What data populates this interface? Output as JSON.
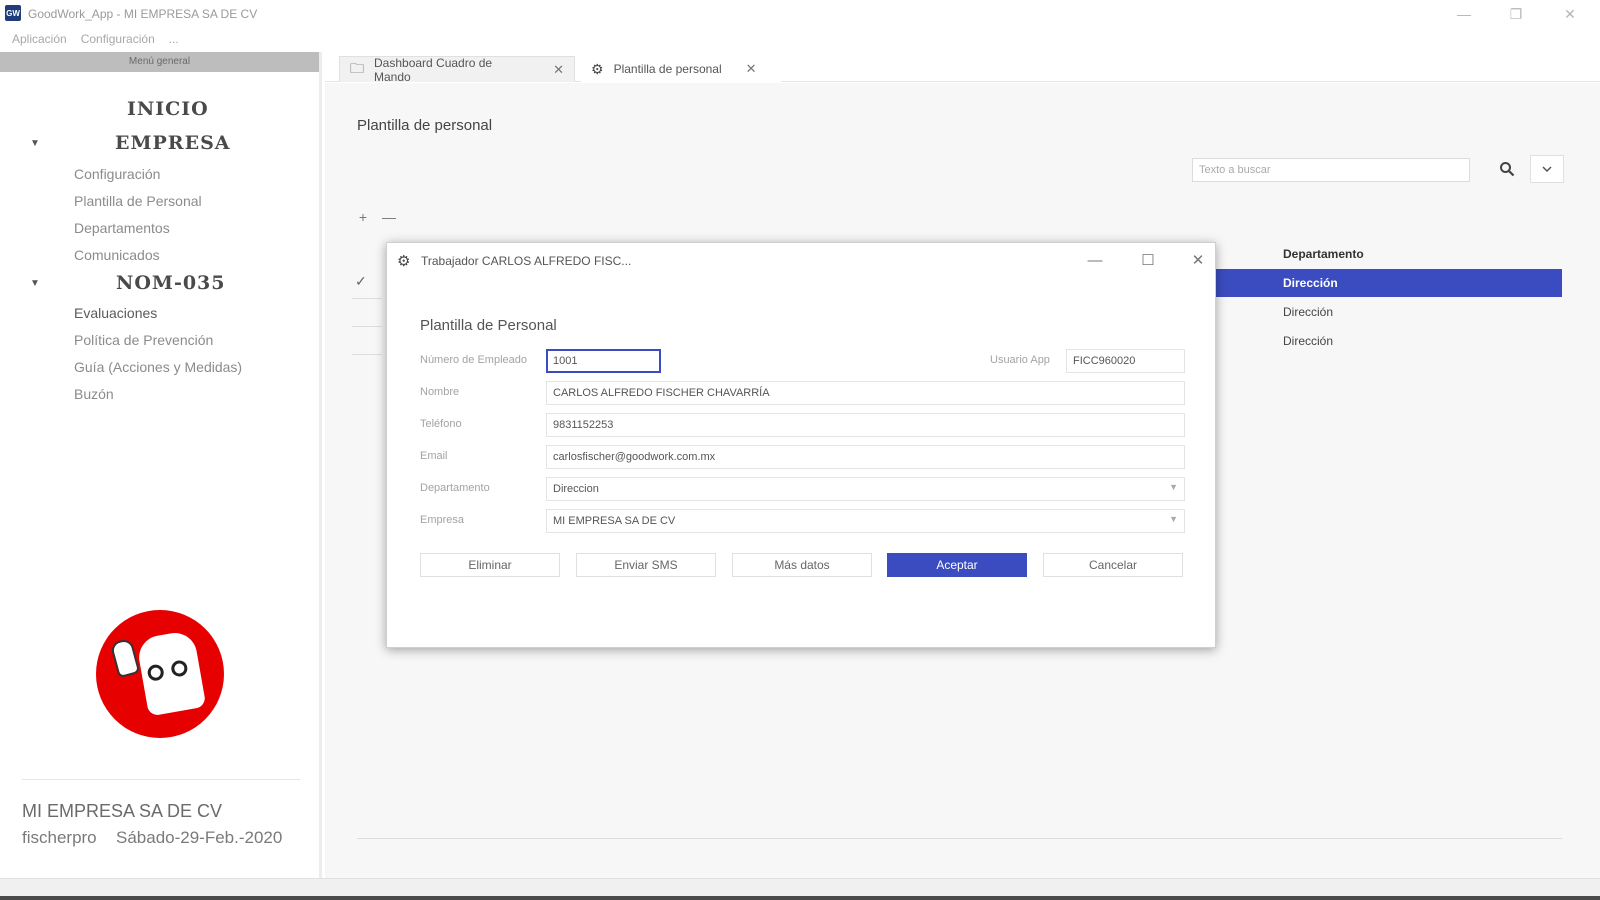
{
  "window": {
    "icon": "GW",
    "title": "GoodWork_App - MI EMPRESA SA DE CV",
    "minimize_icon": "—",
    "restore_icon": "❐",
    "close_icon": "✕"
  },
  "menubar": {
    "items": [
      "Aplicación",
      "Configuración",
      "..."
    ]
  },
  "sidebar": {
    "header": "Menú general",
    "sections": [
      {
        "heading": "INICIO"
      },
      {
        "heading": "EMPRESA",
        "items": [
          "Configuración",
          "Plantilla de Personal",
          "Departamentos",
          "Comunicados"
        ]
      },
      {
        "heading": "NOM-035",
        "items": [
          "Evaluaciones",
          "Política de Prevención",
          "Guía (Acciones y Medidas)",
          "Buzón"
        ]
      }
    ],
    "footer": {
      "company": "MI EMPRESA SA DE CV",
      "user": "fischerpro",
      "date": "Sábado-29-Feb.-2020"
    }
  },
  "tabs": [
    {
      "label": "Dashboard Cuadro de Mando",
      "icon": "folder-icon",
      "active": false
    },
    {
      "label": "Plantilla de personal",
      "icon": "gear-icon",
      "active": true
    }
  ],
  "main": {
    "title": "Plantilla de personal",
    "search_placeholder": "Texto a buscar",
    "add_symbol": "+",
    "remove_symbol": "—",
    "table": {
      "column_header": "Departamento",
      "rows": [
        "Dirección",
        "Dirección",
        "Dirección"
      ]
    }
  },
  "dialog": {
    "title": "Trabajador CARLOS ALFREDO FISC...",
    "form_title": "Plantilla de Personal",
    "fields": {
      "employee_number": {
        "label": "Número de Empleado",
        "value": "1001"
      },
      "app_user": {
        "label": "Usuario App",
        "value": "FICC960020"
      },
      "name": {
        "label": "Nombre",
        "value": "CARLOS ALFREDO FISCHER CHAVARRÍA"
      },
      "phone": {
        "label": "Teléfono",
        "value": "9831152253"
      },
      "email": {
        "label": "Email",
        "value": "carlosfischer@goodwork.com.mx"
      },
      "department": {
        "label": "Departamento",
        "value": "Direccion"
      },
      "company": {
        "label": "Empresa",
        "value": "MI EMPRESA SA DE CV"
      }
    },
    "buttons": {
      "delete": "Eliminar",
      "send_sms": "Enviar SMS",
      "more_data": "Más datos",
      "accept": "Aceptar",
      "cancel": "Cancelar"
    }
  },
  "colors": {
    "accent": "#3a4cbf",
    "logo_red": "#e60000"
  }
}
